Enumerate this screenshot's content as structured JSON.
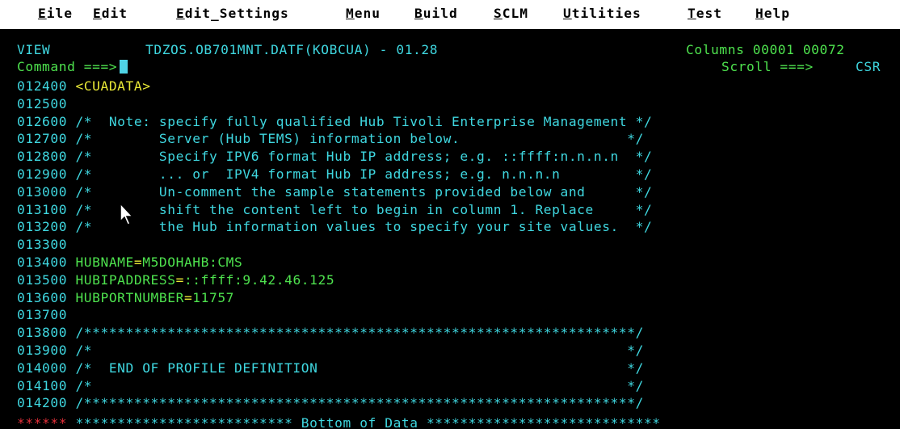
{
  "menubar": {
    "items": [
      {
        "key": "E",
        "rest": "ile"
      },
      {
        "key": "E",
        "rest": "dit"
      },
      {
        "key": "E",
        "rest": "dit_Settings"
      },
      {
        "key": "M",
        "rest": "enu"
      },
      {
        "key": "B",
        "rest": "uild"
      },
      {
        "key": "S",
        "rest": "CLM"
      },
      {
        "key": "U",
        "rest": "tilities"
      },
      {
        "key": "T",
        "rest": "est"
      },
      {
        "key": "H",
        "rest": "elp"
      }
    ]
  },
  "header": {
    "mode": "VIEW",
    "dataset": "TDZOS.OB701MNT.DATF(KOBCUA) - 01.28",
    "columns_label": "Columns 00001 00072",
    "command_label": "Command ===>",
    "command_value": "",
    "scroll_label": "Scroll ===>",
    "scroll_value": "CSR"
  },
  "lines": [
    {
      "num": "012400",
      "text": "<CUADATA>",
      "color": "yellow"
    },
    {
      "num": "012500",
      "text": "",
      "color": "cyan"
    },
    {
      "num": "012600",
      "text": "/*  Note: specify fully qualified Hub Tivoli Enterprise Management */",
      "color": "cyan"
    },
    {
      "num": "012700",
      "text": "/*        Server (Hub TEMS) information below.                    */",
      "color": "cyan"
    },
    {
      "num": "012800",
      "text": "/*        Specify IPV6 format Hub IP address; e.g. ::ffff:n.n.n.n  */",
      "color": "cyan"
    },
    {
      "num": "012900",
      "text": "/*        ... or  IPV4 format Hub IP address; e.g. n.n.n.n         */",
      "color": "cyan"
    },
    {
      "num": "013000",
      "text": "/*        Un-comment the sample statements provided below and      */",
      "color": "cyan"
    },
    {
      "num": "013100",
      "text": "/*        shift the content left to begin in column 1. Replace     */",
      "color": "cyan"
    },
    {
      "num": "013200",
      "text": "/*        the Hub information values to specify your site values.  */",
      "color": "cyan"
    },
    {
      "num": "013300",
      "text": "",
      "color": "cyan"
    },
    {
      "num": "013400",
      "key": "HUBNAME",
      "eq": "=",
      "value": "M5DOHAHB:CMS",
      "color": "kv"
    },
    {
      "num": "013500",
      "key": "HUBIPADDRESS",
      "eq": "=",
      "value": "::ffff:9.42.46.125",
      "color": "kv"
    },
    {
      "num": "013600",
      "key": "HUBPORTNUMBER",
      "eq": "=",
      "value": "11757",
      "color": "kv"
    },
    {
      "num": "013700",
      "text": "",
      "color": "cyan"
    },
    {
      "num": "013800",
      "text": "/******************************************************************/",
      "color": "cyan"
    },
    {
      "num": "013900",
      "text": "/*                                                                */",
      "color": "cyan"
    },
    {
      "num": "014000",
      "text": "/*  END OF PROFILE DEFINITION                                     */",
      "color": "cyan"
    },
    {
      "num": "014100",
      "text": "/*                                                                */",
      "color": "cyan"
    },
    {
      "num": "014200",
      "text": "/******************************************************************/",
      "color": "cyan"
    }
  ],
  "bottom": {
    "marker": "******",
    "text": "************************** Bottom of Data ****************************"
  },
  "colors": {
    "menubar_bg": "#ffffff",
    "text_cyan": "#3fd7e0",
    "text_green": "#4ee24e",
    "text_yellow": "#e8e836",
    "text_red": "#e8303a",
    "cursor": "#4fd3e5"
  },
  "icons": {
    "pointer": "mouse-pointer-icon"
  }
}
